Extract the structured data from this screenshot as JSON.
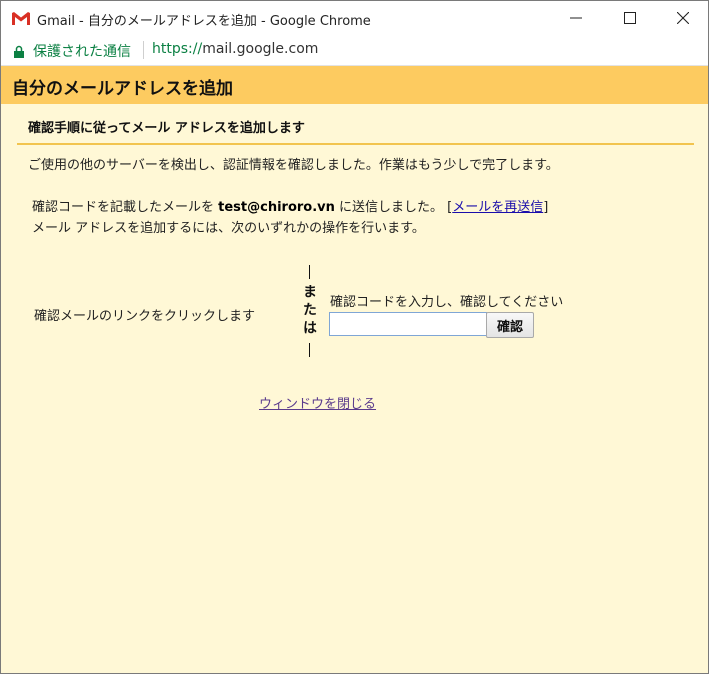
{
  "window": {
    "title": "Gmail - 自分のメールアドレスを追加 - Google Chrome",
    "min_icon": "minimize-icon",
    "max_icon": "maximize-icon",
    "close_icon": "close-icon"
  },
  "addressbar": {
    "secure_label": "保護された通信",
    "url_scheme": "https://",
    "url_host": "mail.google.com"
  },
  "page": {
    "title": "自分のメールアドレスを追加",
    "subheading": "確認手順に従ってメール アドレスを追加します",
    "detected_text": "ご使用の他のサーバーを検出し、認証情報を確認しました。作業はもう少しで完了します。",
    "sent_prefix": "確認コードを記載したメールを ",
    "sent_email": "test@chiroro.vn",
    "sent_suffix": " に送信しました。 [",
    "resend_link": "メールを再送信",
    "sent_close": "]",
    "instruction": "メール アドレスを追加するには、次のいずれかの操作を行います。",
    "option_click": "確認メールのリンクをクリックします",
    "or_text": "または",
    "option_code": "確認コードを入力し、確認してください",
    "code_value": "",
    "confirm_button": "確認",
    "close_window": "ウィンドウを閉じる"
  },
  "colors": {
    "header_bg": "#fdcb60",
    "page_bg": "#fff8d6",
    "secure_green": "#0b8043",
    "link_blue": "#1a0dab"
  }
}
